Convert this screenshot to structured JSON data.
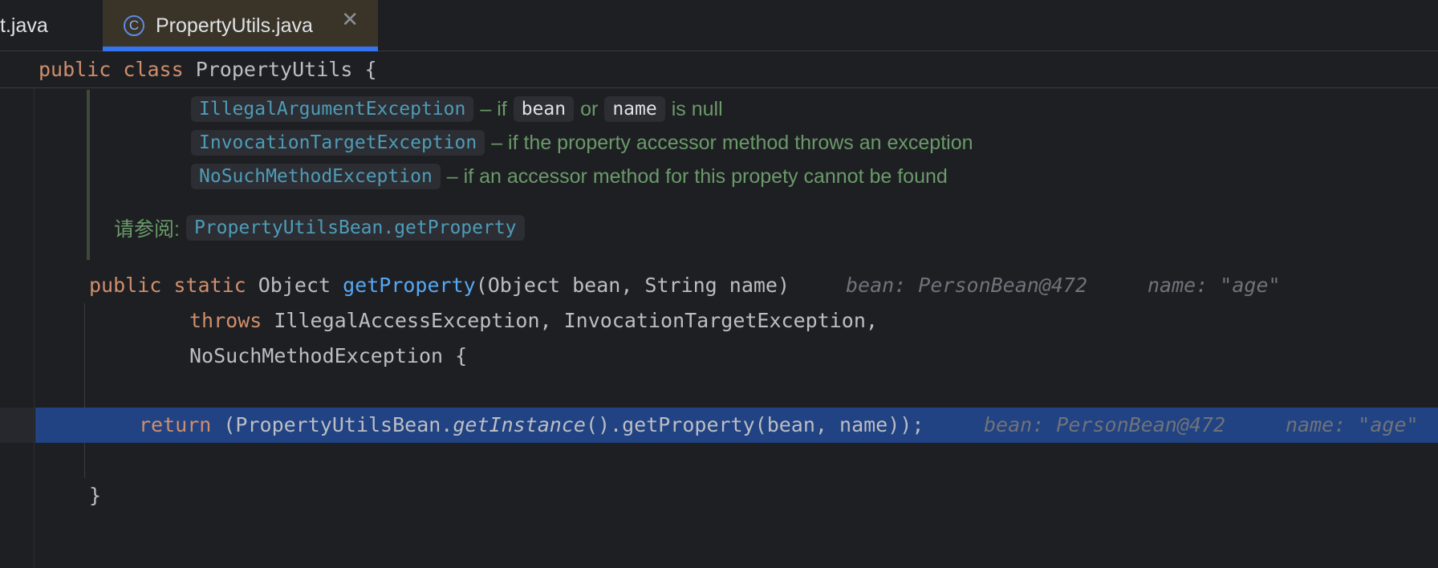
{
  "tabs": [
    {
      "label": "t.java",
      "active": false
    },
    {
      "label": "PropertyUtils.java",
      "active": true,
      "icon": "class-icon",
      "icon_glyph": "C"
    }
  ],
  "sticky_header": {
    "kw1": "public",
    "kw2": "class",
    "name": "PropertyUtils",
    "brace": "{"
  },
  "doc": {
    "throws": [
      {
        "exception": "IllegalArgumentException",
        "pre": "– if",
        "param1": "bean",
        "mid": "or",
        "param2": "name",
        "post": "is null"
      },
      {
        "exception": "InvocationTargetException",
        "text": "– if the property accessor method throws an exception"
      },
      {
        "exception": "NoSuchMethodException",
        "text": "– if an accessor method for this propety cannot be found"
      }
    ],
    "see_label": "请参阅:",
    "see_ref": "PropertyUtilsBean.getProperty"
  },
  "code": {
    "sig_public": "public",
    "sig_static": "static",
    "sig_ret": "Object",
    "sig_name": "getProperty",
    "sig_params": "(Object bean, String name)",
    "hint_bean": "bean: PersonBean@472",
    "hint_name": "name: \"age\"",
    "throws_kw": "throws",
    "throws_list": "IllegalAccessException, InvocationTargetException,",
    "throws_last": "NoSuchMethodException {",
    "ret_kw": "return",
    "ret_pre": "(PropertyUtilsBean.",
    "ret_italic": "getInstance",
    "ret_post": "().getProperty(bean, name));",
    "close_brace": "}"
  },
  "colors": {
    "background": "#1e1f22",
    "execution_line": "#214283",
    "keyword": "#cf8e6d",
    "method": "#56a8f5",
    "doc_text": "#6a9a6a",
    "tab_underline": "#3574f0"
  }
}
